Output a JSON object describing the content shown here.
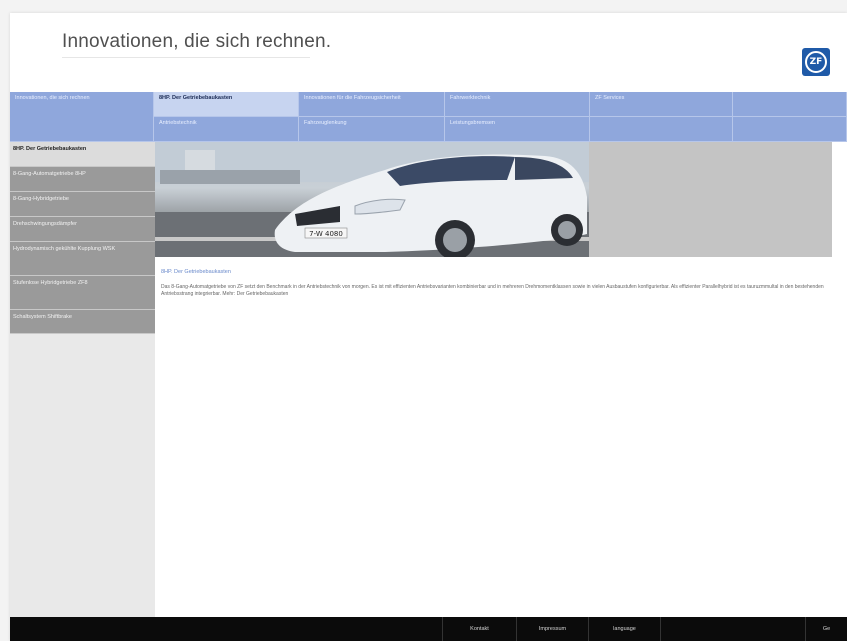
{
  "header": {
    "tagline": "Innovationen, die sich rechnen.",
    "logo_text": "ZF"
  },
  "nav": {
    "cells": [
      {
        "label": "Innovationen, die sich rechnen"
      },
      {
        "label": "8HP. Der Getriebebaukasten"
      },
      {
        "label": "Innovationen für die Fahrzeugsicherheit"
      },
      {
        "label": "Fahrwerktechnik"
      },
      {
        "label": "ZF Services"
      },
      {
        "label": "Antriebstechnik"
      },
      {
        "label": "Fahrzeuglenkung"
      },
      {
        "label": "Leistungsbremsen"
      }
    ]
  },
  "sidebar": {
    "items": [
      {
        "label": "8HP. Der Getriebebaukasten"
      },
      {
        "label": "8-Gang-Automatgetriebe 8HP"
      },
      {
        "label": "8-Gang-Hybridgetriebe"
      },
      {
        "label": "Drehschwingungsdämpfer"
      },
      {
        "label": "Hydrodynamisch gekühlte Kupplung WSK"
      },
      {
        "label": "Stufenlose Hybridgetriebe ZF8"
      },
      {
        "label": "Schaltsystem Shiftbrake"
      }
    ]
  },
  "content": {
    "title": "8HP. Der Getriebebaukasten",
    "body": "Das 8-Gang-Automatgetriebe von ZF setzt den Benchmark in der Antriebstechnik von morgen. Es ist mit effizienten Antriebsvarianten kombinierbar und in mehreren Drehmomentklassen sowie in vielen Ausbaustufen konfigurierbar. Als effizienter Parallelhybrid ist es tauruzmmultal in den bestehenden Antriebsstrang integrierbar. Mehr: Der Getriebebaukasten",
    "license_plate": "7-W 4080"
  },
  "footer": {
    "links": [
      {
        "label": "Kontakt"
      },
      {
        "label": "Impressum"
      },
      {
        "label": "language"
      },
      {
        "label": "Ge"
      }
    ]
  },
  "colors": {
    "nav_blue": "#8fa7dc",
    "nav_active": "#c7d4f0",
    "logo_blue": "#1f5aa8",
    "footer": "#0b0b0b"
  }
}
